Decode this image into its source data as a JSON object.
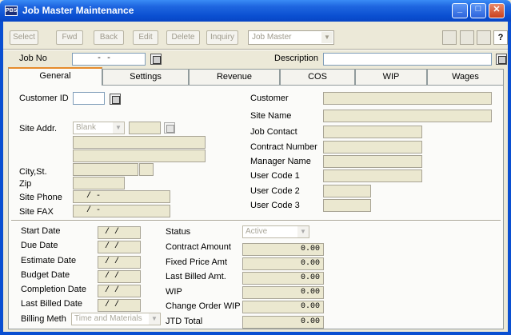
{
  "window": {
    "title": "Job Master Maintenance",
    "app_icon": "PBS"
  },
  "toolbar": {
    "buttons": [
      "Select",
      "Fwd",
      "Back",
      "Edit",
      "Delete",
      "Inquiry"
    ],
    "view_combo": "Job Master"
  },
  "header": {
    "job_no_label": "Job No",
    "job_no_value": "-        -",
    "description_label": "Description",
    "description_value": ""
  },
  "tabs": [
    "General",
    "Settings",
    "Revenue",
    "COS",
    "WIP",
    "Wages"
  ],
  "active_tab": "General",
  "general": {
    "customer_id_label": "Customer ID",
    "site_addr_label": "Site Addr.",
    "site_addr_select": "Blank",
    "city_label": "City,St.",
    "zip_label": "Zip",
    "site_phone_label": "Site Phone",
    "site_phone_mask": "   /    -",
    "site_fax_label": "Site FAX",
    "site_fax_mask": "   /    -",
    "right_labels": {
      "customer": "Customer",
      "site_name": "Site Name",
      "job_contact": "Job Contact",
      "contract_number": "Contract Number",
      "manager_name": "Manager Name",
      "user_code_1": "User Code 1",
      "user_code_2": "User Code 2",
      "user_code_3": "User Code 3"
    },
    "dates": {
      "start": "Start Date",
      "due": "Due Date",
      "estimate": "Estimate Date",
      "budget": "Budget Date",
      "completion": "Completion Date",
      "last_billed": "Last Billed Date",
      "mask": "  /  /"
    },
    "billing_meth_label": "Billing Meth",
    "billing_meth_value": "Time and Materials",
    "status_label": "Status",
    "status_value": "Active",
    "amounts": {
      "contract_amount_label": "Contract Amount",
      "contract_amount": "0.00",
      "fixed_price_label": "Fixed Price Amt",
      "fixed_price": "0.00",
      "last_billed_label": "Last Billed Amt.",
      "last_billed": "0.00",
      "wip_label": "WIP",
      "wip": "0.00",
      "change_order_label": "Change Order WIP",
      "change_order": "0.00",
      "jtd_label": "JTD Total",
      "jtd": "0.00"
    }
  }
}
